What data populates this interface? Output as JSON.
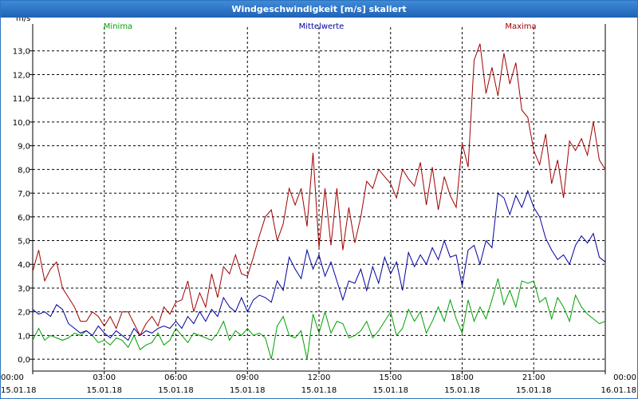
{
  "window": {
    "title": "Windgeschwindigkeit [m/s] skaliert"
  },
  "chart_data": {
    "type": "line",
    "ylabel": "m/s",
    "ylim": [
      -0.5,
      14.0
    ],
    "y_ticks": [
      "0,0",
      "1,0",
      "2,0",
      "3,0",
      "4,0",
      "5,0",
      "6,0",
      "7,0",
      "8,0",
      "9,0",
      "10,0",
      "11,0",
      "12,0",
      "13,0"
    ],
    "x_ticks": [
      {
        "time": "00:00",
        "date": "15.01.18"
      },
      {
        "time": "03:00",
        "date": "15.01.18"
      },
      {
        "time": "06:00",
        "date": "15.01.18"
      },
      {
        "time": "09:00",
        "date": "15.01.18"
      },
      {
        "time": "12:00",
        "date": "15.01.18"
      },
      {
        "time": "15:00",
        "date": "15.01.18"
      },
      {
        "time": "18:00",
        "date": "15.01.18"
      },
      {
        "time": "21:00",
        "date": "15.01.18"
      },
      {
        "time": "00:00",
        "date": "16.01.18"
      }
    ],
    "x_hours": [
      0.0,
      0.25,
      0.5,
      0.75,
      1.0,
      1.25,
      1.5,
      1.75,
      2.0,
      2.25,
      2.5,
      2.75,
      3.0,
      3.25,
      3.5,
      3.75,
      4.0,
      4.25,
      4.5,
      4.75,
      5.0,
      5.25,
      5.5,
      5.75,
      6.0,
      6.25,
      6.5,
      6.75,
      7.0,
      7.25,
      7.5,
      7.75,
      8.0,
      8.25,
      8.5,
      8.75,
      9.0,
      9.25,
      9.5,
      9.75,
      10.0,
      10.25,
      10.5,
      10.75,
      11.0,
      11.25,
      11.5,
      11.75,
      12.0,
      12.25,
      12.5,
      12.75,
      13.0,
      13.25,
      13.5,
      13.75,
      14.0,
      14.25,
      14.5,
      14.75,
      15.0,
      15.25,
      15.5,
      15.75,
      16.0,
      16.25,
      16.5,
      16.75,
      17.0,
      17.25,
      17.5,
      17.75,
      18.0,
      18.25,
      18.5,
      18.75,
      19.0,
      19.25,
      19.5,
      19.75,
      20.0,
      20.25,
      20.5,
      20.75,
      21.0,
      21.25,
      21.5,
      21.75,
      22.0,
      22.25,
      22.5,
      22.75,
      23.0,
      23.25,
      23.5,
      23.75,
      24.0
    ],
    "series": [
      {
        "name": "Minima",
        "color": "#00a000",
        "values": [
          0.8,
          1.3,
          0.8,
          1.0,
          0.9,
          0.8,
          0.9,
          1.1,
          1.0,
          1.2,
          1.0,
          0.7,
          0.8,
          0.6,
          0.9,
          0.8,
          0.5,
          1.0,
          0.4,
          0.6,
          0.7,
          1.1,
          0.6,
          0.8,
          1.3,
          1.0,
          0.7,
          1.1,
          1.0,
          0.9,
          0.8,
          1.1,
          1.6,
          0.8,
          1.2,
          1.0,
          1.3,
          1.0,
          1.1,
          0.9,
          0.0,
          1.4,
          1.8,
          1.0,
          0.9,
          1.2,
          0.0,
          1.9,
          1.1,
          2.0,
          1.1,
          1.6,
          1.5,
          0.9,
          1.0,
          1.2,
          1.6,
          0.9,
          1.2,
          1.6,
          2.0,
          1.0,
          1.3,
          2.1,
          1.6,
          2.0,
          1.1,
          1.6,
          2.2,
          1.6,
          2.5,
          1.7,
          1.1,
          2.5,
          1.6,
          2.2,
          1.7,
          2.5,
          3.4,
          2.3,
          2.9,
          2.2,
          3.3,
          3.2,
          3.3,
          2.4,
          2.6,
          1.7,
          2.6,
          2.2,
          1.6,
          2.7,
          2.2,
          1.9,
          1.7,
          1.5,
          1.6
        ]
      },
      {
        "name": "Mittelwerte",
        "color": "#0000a0",
        "values": [
          2.1,
          1.9,
          2.0,
          1.8,
          2.3,
          2.1,
          1.5,
          1.3,
          1.1,
          1.2,
          1.0,
          1.4,
          1.1,
          0.9,
          1.2,
          1.0,
          0.8,
          1.3,
          1.0,
          1.2,
          1.1,
          1.3,
          1.4,
          1.3,
          1.6,
          1.3,
          1.8,
          1.5,
          2.0,
          1.6,
          2.1,
          1.8,
          2.6,
          2.2,
          2.0,
          2.6,
          2.0,
          2.5,
          2.7,
          2.6,
          2.4,
          3.3,
          2.9,
          4.3,
          3.8,
          3.4,
          4.6,
          3.8,
          4.4,
          3.5,
          4.1,
          3.3,
          2.5,
          3.3,
          3.2,
          3.8,
          2.9,
          3.9,
          3.2,
          4.3,
          3.6,
          4.1,
          2.9,
          4.5,
          3.9,
          4.4,
          4.0,
          4.7,
          4.2,
          5.0,
          4.3,
          4.4,
          3.1,
          4.6,
          4.8,
          4.0,
          5.0,
          4.7,
          7.0,
          6.8,
          6.1,
          6.9,
          6.4,
          7.1,
          6.4,
          6.0,
          5.1,
          4.6,
          4.2,
          4.4,
          4.0,
          4.8,
          5.2,
          4.9,
          5.3,
          4.3,
          4.1
        ]
      },
      {
        "name": "Maxima",
        "color": "#a00000",
        "values": [
          3.7,
          4.6,
          3.3,
          3.8,
          4.1,
          3.0,
          2.6,
          2.2,
          1.6,
          1.6,
          2.0,
          1.8,
          1.4,
          1.8,
          1.3,
          2.0,
          2.0,
          1.5,
          1.0,
          1.5,
          1.8,
          1.4,
          2.2,
          1.9,
          2.4,
          2.5,
          3.3,
          2.0,
          2.8,
          2.2,
          3.6,
          2.6,
          3.9,
          3.6,
          4.4,
          3.6,
          3.5,
          4.3,
          5.2,
          6.0,
          6.3,
          5.0,
          5.7,
          7.2,
          6.5,
          7.2,
          5.6,
          8.7,
          4.7,
          7.2,
          4.8,
          7.2,
          4.6,
          6.4,
          4.9,
          6.0,
          7.5,
          7.2,
          8.0,
          7.7,
          7.4,
          6.8,
          8.0,
          7.6,
          7.3,
          8.3,
          6.5,
          8.1,
          6.3,
          7.7,
          6.9,
          6.4,
          9.1,
          8.1,
          12.6,
          13.3,
          11.2,
          12.3,
          11.1,
          12.9,
          11.6,
          12.5,
          10.5,
          10.2,
          8.8,
          8.2,
          9.5,
          7.4,
          8.4,
          6.8,
          9.2,
          8.8,
          9.3,
          8.6,
          10.0,
          8.4,
          8.0
        ]
      }
    ]
  }
}
